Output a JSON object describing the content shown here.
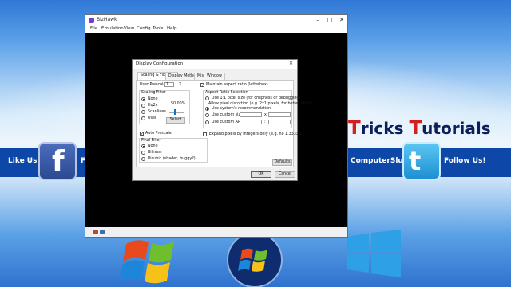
{
  "app": {
    "title": "BizHawk",
    "menu": [
      "File",
      "Emulation",
      "View",
      "Config",
      "Tools",
      "Help"
    ],
    "controls": {
      "minimize": "–",
      "maximize": "□",
      "close": "✕"
    }
  },
  "dialog": {
    "title": "Display Configuration",
    "close": "✕",
    "tabs": [
      "Scaling & Filtering",
      "Display Method",
      "Misc",
      "Window"
    ],
    "user_prescale_label": "User Prescale",
    "user_prescale_value": "1",
    "user_prescale_suffix": "X",
    "scaling_filter": {
      "title": "Scaling Filter",
      "options": [
        "None",
        "Hq2x",
        "Scanlines",
        "User"
      ],
      "selected": "None",
      "percent": "50.00%",
      "select_button": "Select"
    },
    "auto_prescale": {
      "label": "Auto Prescale",
      "checked": true
    },
    "final_filter": {
      "title": "Final Filter",
      "options": [
        "None",
        "Bilinear",
        "Bicubic (shader, buggy?)"
      ],
      "selected": "None"
    },
    "maintain_aspect": {
      "label": "Maintain aspect ratio (letterbox)",
      "checked": true
    },
    "aspect_ratio_selection": {
      "title": "Aspect Ratio Selection",
      "use_1to1": "Use 1:1 pixel size (for crispness or debugging)",
      "allow_distortion": "Allow pixel distortion (e.g. 2x1 pixels, for better AR fit):",
      "options": [
        "Use system's recommendation",
        "Use custom size:",
        "Use custom AR:"
      ],
      "selected": "Use system's recommendation",
      "x_sep": "x",
      "colon_sep": ":"
    },
    "expand_pixels": {
      "label": "Expand pixels by integers only (e.g. no 1.3333x)",
      "checked": false
    },
    "defaults_button": "Defaults",
    "ok_button": "OK",
    "cancel_button": "Cancel"
  },
  "desktop": {
    "left_banner": "Like Us!",
    "left_banner_partial": "F",
    "brand_word1_cap": "T",
    "brand_word1_rest": "ricks",
    "brand_word2_cap": "T",
    "brand_word2_rest": "utorials",
    "handle": "ComputerSlug",
    "right_banner": "Follow Us!",
    "facebook_letter": "f",
    "twitter_letter": "t"
  },
  "colors": {
    "banner": "#0d47a8",
    "brand_text": "#0c1f5a",
    "brand_cap": "#d41f1f",
    "accent": "#0078d7"
  }
}
